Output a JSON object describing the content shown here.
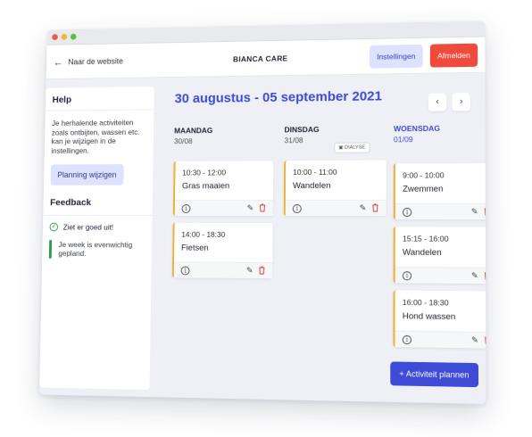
{
  "window": {
    "controls": [
      "close",
      "minimize",
      "maximize"
    ]
  },
  "appbar": {
    "back_label": "Naar de website",
    "brand": "BIANCA CARE",
    "settings_label": "Instellingen",
    "logout_label": "Afmelden"
  },
  "help": {
    "title": "Help",
    "text": "Je herhalende activiteiten zoals ontbijten, wassen etc. kan je wijzigen in de instellingen.",
    "button_label": "Planning wijzigen"
  },
  "feedback": {
    "title": "Feedback",
    "status": "Ziet er goed uit!",
    "note": "Je week is evenwichtig gepland."
  },
  "week": {
    "range_label": "30 augustus - 05 september 2021",
    "prev_icon": "chevron-left-icon",
    "next_icon": "chevron-right-icon",
    "days": [
      {
        "name": "MAANDAG",
        "date": "30/08"
      },
      {
        "name": "DINSDAG",
        "date": "31/08",
        "badge": "DIALYSE"
      },
      {
        "name": "WOENSDAG",
        "date": "01/09",
        "active": true
      }
    ],
    "activities": [
      {
        "time": "10:30 - 12:00",
        "title": "Gras maaien"
      },
      {
        "time": "14:00 - 18:30",
        "title": "Fietsen"
      },
      {
        "time": "10:00 - 11:00",
        "title": "Wandelen"
      },
      {
        "time": "9:00 - 10:00",
        "title": "Zwemmen"
      },
      {
        "time": "15:15 - 16:00",
        "title": "Wandelen"
      },
      {
        "time": "16:00 - 18:30",
        "title": "Hond wassen"
      }
    ],
    "add_label": "+ Activiteit plannen"
  },
  "colors": {
    "accent": "#3b4bd4",
    "danger": "#ef4a3c",
    "activity_bar": "#f0b13a",
    "success": "#2e9a4f"
  }
}
